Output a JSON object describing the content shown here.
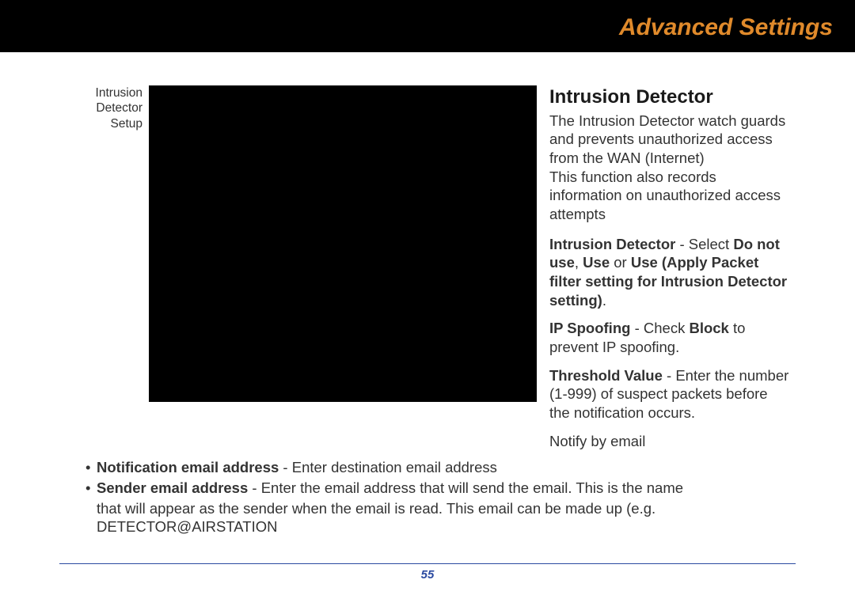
{
  "header": {
    "title": "Advanced Settings"
  },
  "left_caption": {
    "l1": "Intrusion",
    "l2": "Detector",
    "l3": "Setup"
  },
  "section": {
    "heading": "Intrusion Detector",
    "intro1": "The Intrusion Detector watch guards and prevents unauthorized access from the WAN (Internet)",
    "intro2": "This function also records information on unauthorized access attempts",
    "p1_b1": "Intrusion Detector",
    "p1_t1": " - Select ",
    "p1_b2": "Do not use",
    "p1_t2": ", ",
    "p1_b3": "Use",
    "p1_t3": " or ",
    "p1_b4": "Use (Apply Packet filter setting for Intrusion Detector setting)",
    "p1_t4": ".",
    "p2_b1": "IP Spoofing",
    "p2_t1": " - Check ",
    "p2_b2": "Block",
    "p2_t2": " to prevent IP spoofing.",
    "p3_b1": "Threshold Value",
    "p3_t1": " - Enter the number (1-999) of suspect packets before the notification occurs.",
    "p4": "Notify by email"
  },
  "bullets": {
    "b1_label": "Notification email address",
    "b1_text": " - Enter destination email address",
    "b2_label": "Sender email address",
    "b2_text": " - Enter the email address that will send the email.  This is the name",
    "b2_cont1": "that will appear as the sender when the email is read.  This email can be made up (e.g.",
    "b2_cont2": "DETECTOR@AIRSTATION"
  },
  "page_number": "55"
}
